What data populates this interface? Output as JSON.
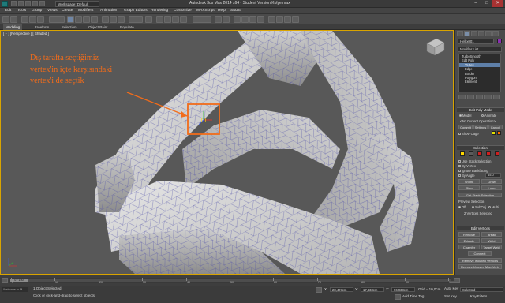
{
  "window": {
    "title": "Autodesk 3ds Max 2014 x64  -  Student Version   Kolye.max",
    "workspace": "Workspace: Default",
    "min": "–",
    "max": "□",
    "close": "✕"
  },
  "menu": [
    "Edit",
    "Tools",
    "Group",
    "Views",
    "Create",
    "Modifiers",
    "Animation",
    "Graph Editors",
    "Rendering",
    "Customize",
    "MAXScript",
    "Help",
    "SMZE"
  ],
  "ribbon": {
    "tabs": [
      "Modeling",
      "Freeform",
      "Selection",
      "Object Paint",
      "Populate"
    ]
  },
  "viewport": {
    "label": "[ + ] [Perspective ] [ Shaded ]",
    "annotation": "Dış tarafta seçtiğimiz vertex'in içte karşısındaki vertex'i de seçtik",
    "annotation_color": "#f26c1a"
  },
  "command_panel": {
    "object_name": "Hellix001",
    "modifier_list": "Modifier List",
    "stack": [
      "TurboSmooth",
      "Edit Poly",
      "Vertex",
      "Edge",
      "Border",
      "Polygon",
      "Element"
    ],
    "stack_selected": "Vertex",
    "editpoly_mode_head": "Edit Poly Mode",
    "model": "Model",
    "animate": "Animate",
    "current_op": "<No Current Operation>",
    "commit": "Commit",
    "settings": "Settings",
    "cancel": "Cancel",
    "show_cage": "Show Cage",
    "selection_head": "Selection",
    "use_stack": "Use Stack Selection",
    "by_vertex": "By Vertex",
    "ignore_backfacing": "Ignore Backfacing",
    "by_angle": "By Angle",
    "angle": "45.0",
    "shrink": "Shrink",
    "grow": "Grow",
    "ring": "Ring",
    "loop": "Loop",
    "get_stack": "Get Stack Selection",
    "preview_selection": "Preview Selection",
    "preview_off": "Off",
    "preview_subobj": "SubObj",
    "preview_multi": "Multi",
    "selected_count": "2 Vertices Selected",
    "edit_vertices_head": "Edit Vertices",
    "remove": "Remove",
    "break": "Break",
    "extrude": "Extrude",
    "weld": "Weld",
    "chamfer": "Chamfer",
    "target_weld": "Target Weld",
    "connect": "Connect",
    "remove_isolated": "Remove Isolated Vertices",
    "remove_unused": "Remove Unused Map Verts"
  },
  "timeline": {
    "frame": "0 / 100",
    "ticks": [
      "0",
      "10",
      "20",
      "30",
      "40",
      "50",
      "60",
      "70",
      "80",
      "90",
      "100"
    ]
  },
  "status": {
    "selected": "1 Object Selected",
    "prompt": "Click or click-and-drag to select objects",
    "x_label": "X:",
    "x": "28,427cm",
    "y_label": "Y:",
    "y": "17,833cm",
    "z_label": "Z:",
    "z": "96,938cm",
    "grid": "Grid = 10,0cm",
    "add_time_tag": "Add Time Tag",
    "auto_key": "Auto Key",
    "set_key": "Set Key",
    "key_filters": "Key Filters...",
    "selected_dropdown": "Selected",
    "welcome": "Welcome to M"
  },
  "colors": {
    "accent": "#f26c1a",
    "viewport_border": "#d9a400",
    "selection_red": "#d01e1e",
    "selection_yellow": "#ffd800",
    "stack_highlight": "#5e7fa8"
  }
}
